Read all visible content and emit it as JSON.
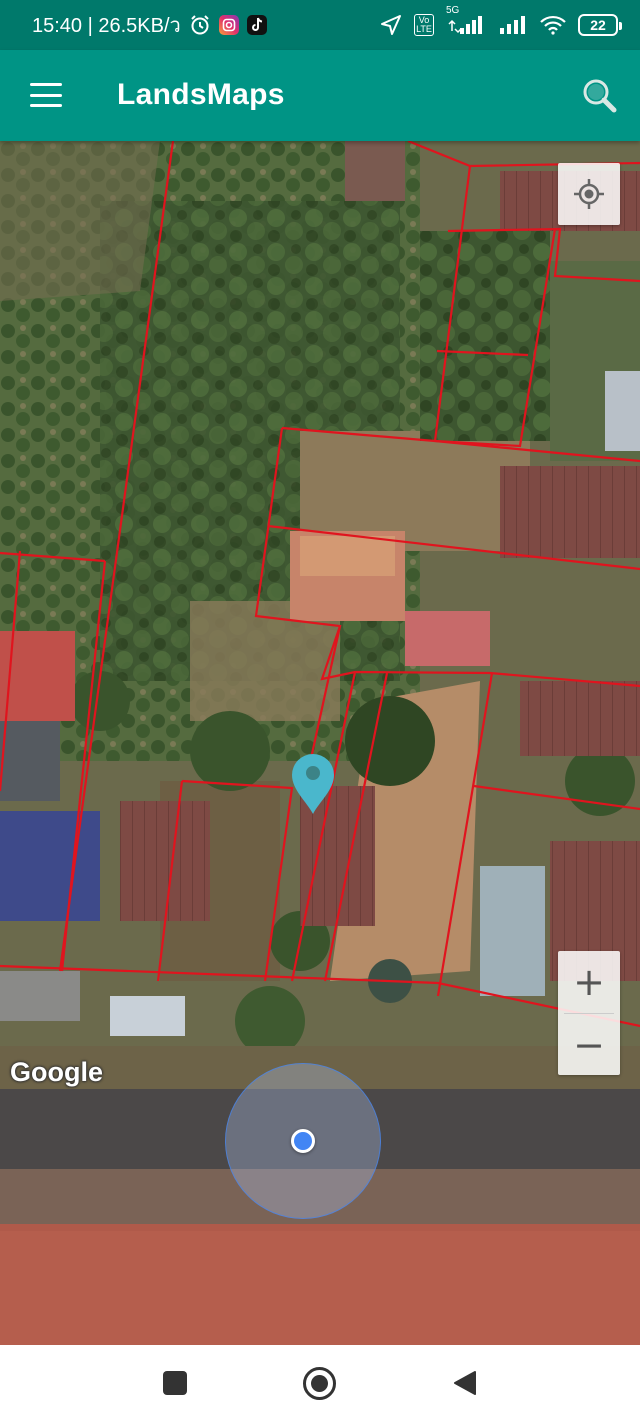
{
  "status_bar": {
    "time_speed": "15:40 | 26.5KB/ว",
    "alarm_icon": "alarm-clock-icon",
    "app_icons": [
      "instagram-icon",
      "tiktok-icon"
    ],
    "network_label": "5G",
    "volte_label": "Vo LTE",
    "battery_level": "22"
  },
  "app_bar": {
    "title": "LandsMaps",
    "menu_icon": "hamburger-menu-icon",
    "search_icon": "search-icon",
    "color": "#009485"
  },
  "map": {
    "attribution": "Google",
    "zoom_in_label": "+",
    "zoom_out_label": "−",
    "locate_icon": "my-location-icon",
    "pin_color": "#4ab7cc",
    "parcel_line_color": "#e0141e",
    "location_dot_color": "#4285f4"
  },
  "nav_bar": {
    "recent_icon": "recent-apps-icon",
    "home_icon": "home-icon",
    "back_icon": "back-icon"
  }
}
